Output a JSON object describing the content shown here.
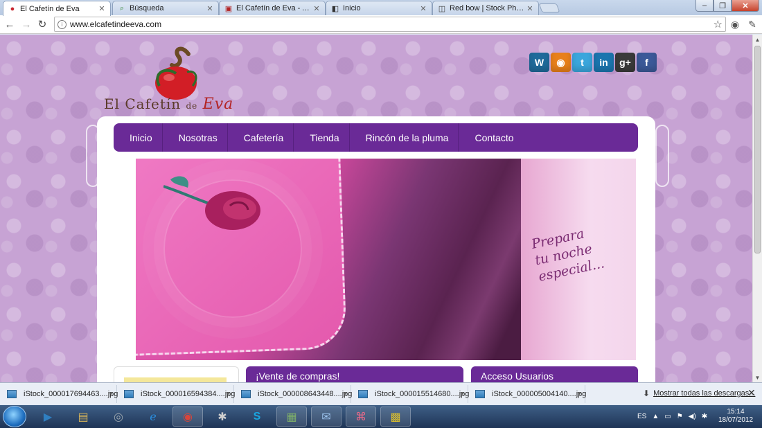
{
  "browser": {
    "tabs": [
      {
        "title": "El Cafetín de Eva",
        "icon": "apple-favicon-icon",
        "active": true
      },
      {
        "title": "Búsqueda",
        "icon": "search-favicon-icon",
        "active": false
      },
      {
        "title": "El Cafetín de Eva - Admini",
        "icon": "admin-favicon-icon",
        "active": false
      },
      {
        "title": "Inicio",
        "icon": "page-favicon-icon",
        "active": false
      },
      {
        "title": "Red bow | Stock Photo | iSt",
        "icon": "istock-favicon-icon",
        "active": false
      }
    ],
    "url": "www.elcafetindeeva.com",
    "window_controls": {
      "minimize": "–",
      "maximize": "❐",
      "close": "✕"
    }
  },
  "site": {
    "logo": {
      "text_main": "El Cafetín",
      "text_de": "de",
      "text_accent": "Eva"
    },
    "social": [
      {
        "name": "wordpress-icon",
        "glyph": "W",
        "color": "#1f6a9a"
      },
      {
        "name": "rss-icon",
        "glyph": "◉",
        "color": "#e8801a"
      },
      {
        "name": "twitter-icon",
        "glyph": "t",
        "color": "#3aa6dc"
      },
      {
        "name": "linkedin-icon",
        "glyph": "in",
        "color": "#1b75ae"
      },
      {
        "name": "googleplus-icon",
        "glyph": "g+",
        "color": "#3a3a3a"
      },
      {
        "name": "facebook-icon",
        "glyph": "f",
        "color": "#3b5998"
      }
    ],
    "menu": [
      "Inicio",
      "Nosotras",
      "Cafetería",
      "Tienda",
      "Rincón de la pluma",
      "Contacto"
    ],
    "banner": {
      "tagline_line1": "Prepara",
      "tagline_line2": "tu noche",
      "tagline_line3": "especial..."
    },
    "boxes": {
      "shop": "¡Vente de compras!",
      "login": "Acceso Usuarios"
    },
    "colors": {
      "menu_purple": "#6a2a97",
      "background_lilac": "#c7a3d4"
    }
  },
  "downloads": {
    "items": [
      "iStock_000017694463....jpg",
      "iStock_000016594384....jpg",
      "iStock_000008643448....jpg",
      "iStock_000015514680....jpg",
      "iStock_000005004140....jpg"
    ],
    "show_all": "Mostrar todas las descargas...",
    "close": "✕"
  },
  "taskbar": {
    "language": "ES",
    "time": "15:14",
    "date": "18/07/2012",
    "apps": [
      {
        "name": "media-player-app-icon",
        "glyph": "▶",
        "color": "#2f7fc1"
      },
      {
        "name": "explorer-app-icon",
        "glyph": "▤",
        "color": "#d6b45a"
      },
      {
        "name": "disc-app-icon",
        "glyph": "◎",
        "color": "#9aa5ad"
      },
      {
        "name": "ie-app-icon",
        "glyph": "e",
        "color": "#2a8fe0"
      },
      {
        "name": "chrome-app-icon",
        "glyph": "◉",
        "color": "#d9453a"
      },
      {
        "name": "settings-app-icon",
        "glyph": "✱",
        "color": "#777"
      },
      {
        "name": "skype-app-icon",
        "glyph": "S",
        "color": "#19a6e0"
      },
      {
        "name": "files-app-icon",
        "glyph": "▦",
        "color": "#7fb069"
      },
      {
        "name": "mail-app-icon",
        "glyph": "✉",
        "color": "#4a78b5"
      },
      {
        "name": "acrobat-app-icon",
        "glyph": "⌘",
        "color": "#c4264a"
      },
      {
        "name": "video-app-icon",
        "glyph": "▩",
        "color": "#e0c22a"
      }
    ]
  }
}
